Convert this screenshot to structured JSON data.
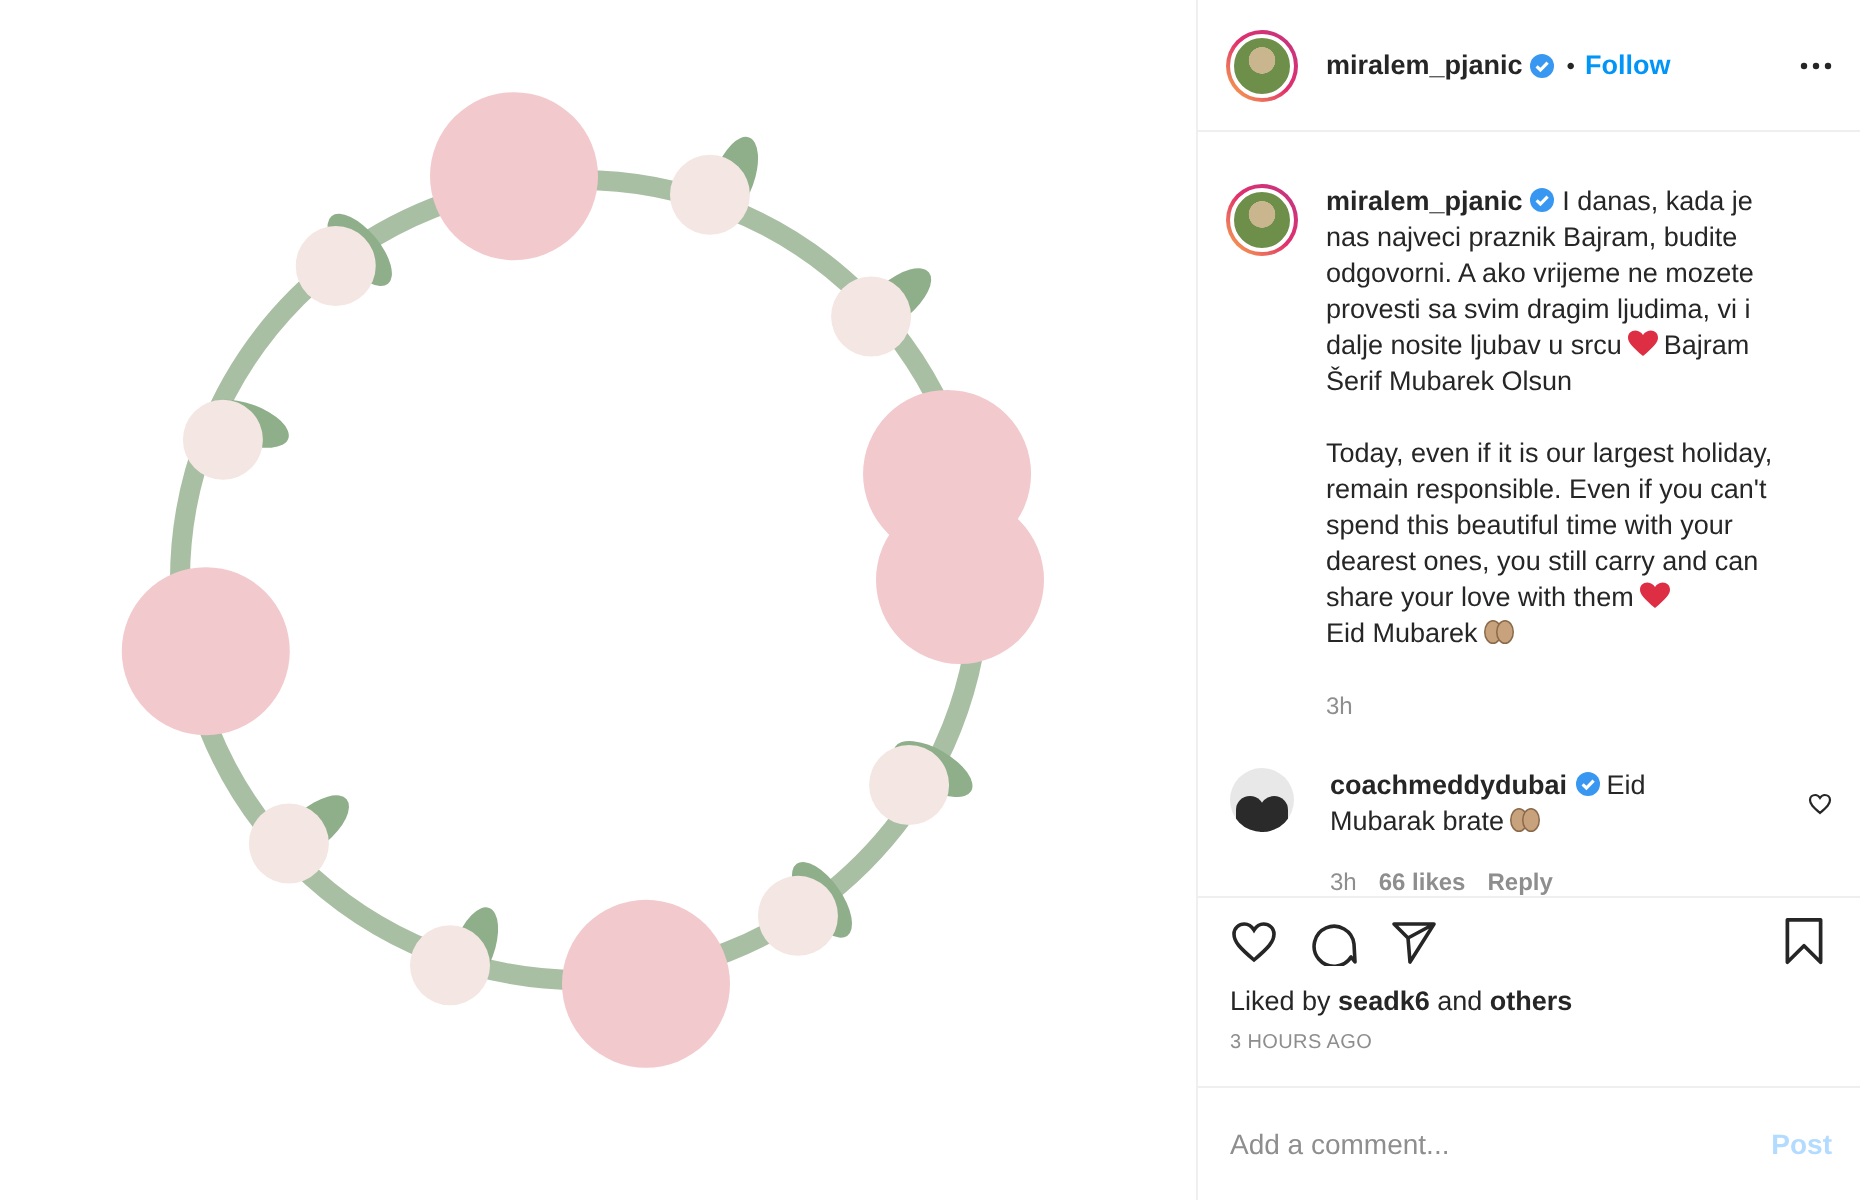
{
  "header": {
    "username": "miralem_pjanic",
    "verified": true,
    "separator": "•",
    "follow": "Follow"
  },
  "caption": {
    "username": "miralem_pjanic",
    "verified": true,
    "paragraphs": [
      [
        {
          "kind": "text",
          "text": "I danas, kada je nas najveci praznik Bajram, budite odgovorni. A ako vrijeme ne mozete provesti sa svim dragim ljudima, vi i dalje nosite ljubav u srcu"
        },
        {
          "kind": "heart"
        },
        {
          "kind": "text",
          "text": "Bajram Šerif Mubarek Olsun"
        }
      ],
      [
        {
          "kind": "text",
          "text": "Today, even if it is our largest holiday, remain responsible. Even if you can't spend this beautiful time with your dearest ones, you still carry and can share your love with them"
        },
        {
          "kind": "heart"
        },
        {
          "kind": "break"
        },
        {
          "kind": "text",
          "text": "Eid Mubarek"
        },
        {
          "kind": "hands"
        }
      ]
    ],
    "time": "3h"
  },
  "comments": [
    {
      "username": "coachmeddydubai",
      "verified": true,
      "segments": [
        {
          "kind": "text",
          "text": "Eid Mubarak brate"
        },
        {
          "kind": "hands"
        }
      ],
      "time": "3h",
      "likes": "66 likes",
      "reply": "Reply",
      "liked": false
    }
  ],
  "actions": {
    "liked": false,
    "saved": false
  },
  "liked_by": "Liked by **seadk6** and **others**",
  "timestamp": "3 HOURS AGO",
  "comment_box": {
    "placeholder": "Add a comment...",
    "post": "Post",
    "post_enabled": false
  }
}
